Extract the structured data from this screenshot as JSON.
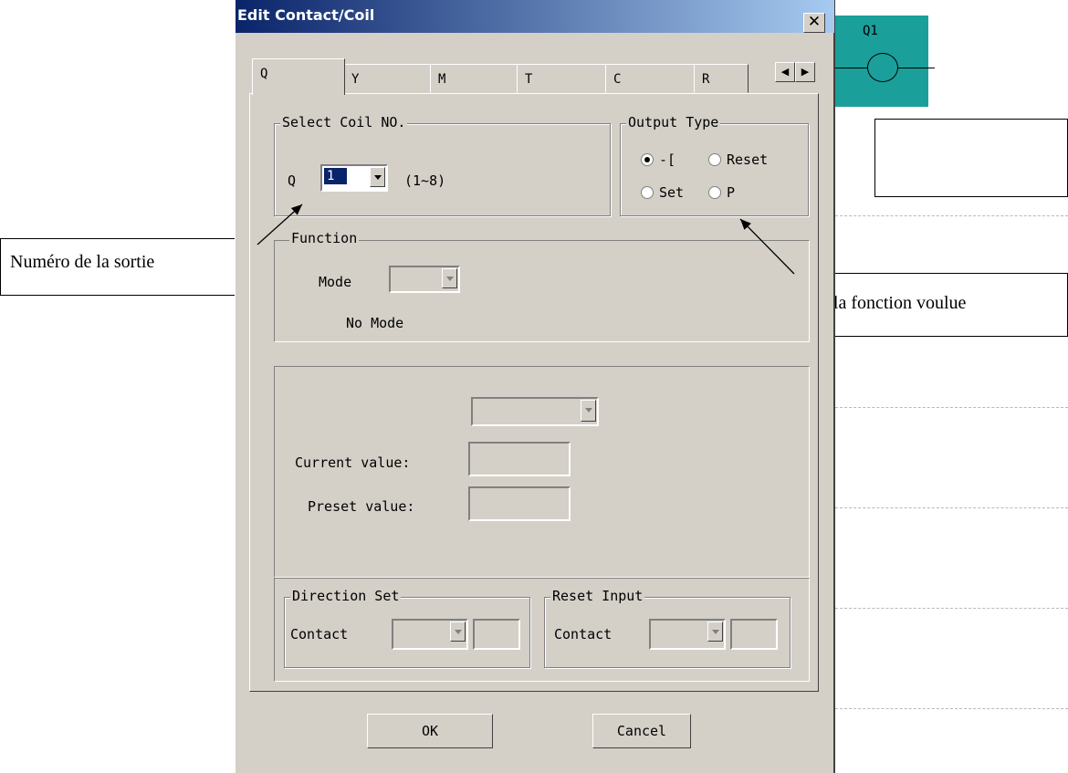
{
  "background": {
    "coil": {
      "label": "Q1",
      "color": "#1a9f9a"
    }
  },
  "dialog": {
    "title": "Edit Contact/Coil",
    "close_icon": "close-icon",
    "tabs": [
      "Q",
      "Y",
      "M",
      "T",
      "C",
      "R"
    ],
    "active_tab": "Q",
    "select_coil": {
      "group_title": "Select Coil NO.",
      "prefix": "Q",
      "value": "1",
      "range": "(1~8)"
    },
    "output_type": {
      "group_title": "Output Type",
      "options": [
        "-[",
        "Reset",
        "Set",
        "P"
      ],
      "selected": "-["
    },
    "function": {
      "group_title": "Function",
      "mode_label": "Mode",
      "mode_value": "",
      "mode_text": "No Mode"
    },
    "values": {
      "current_label": "Current value:",
      "preset_label": "Preset value:",
      "current_value": "",
      "preset_value": ""
    },
    "direction_set": {
      "group_title": "Direction Set",
      "contact_label": "Contact"
    },
    "reset_input": {
      "group_title": "Reset Input",
      "contact_label": "Contact"
    },
    "ok_label": "OK",
    "cancel_label": "Cancel"
  },
  "callouts": {
    "left": "Numéro de la sortie",
    "right": "Choisir la fonction voulue",
    "top_right": ""
  }
}
